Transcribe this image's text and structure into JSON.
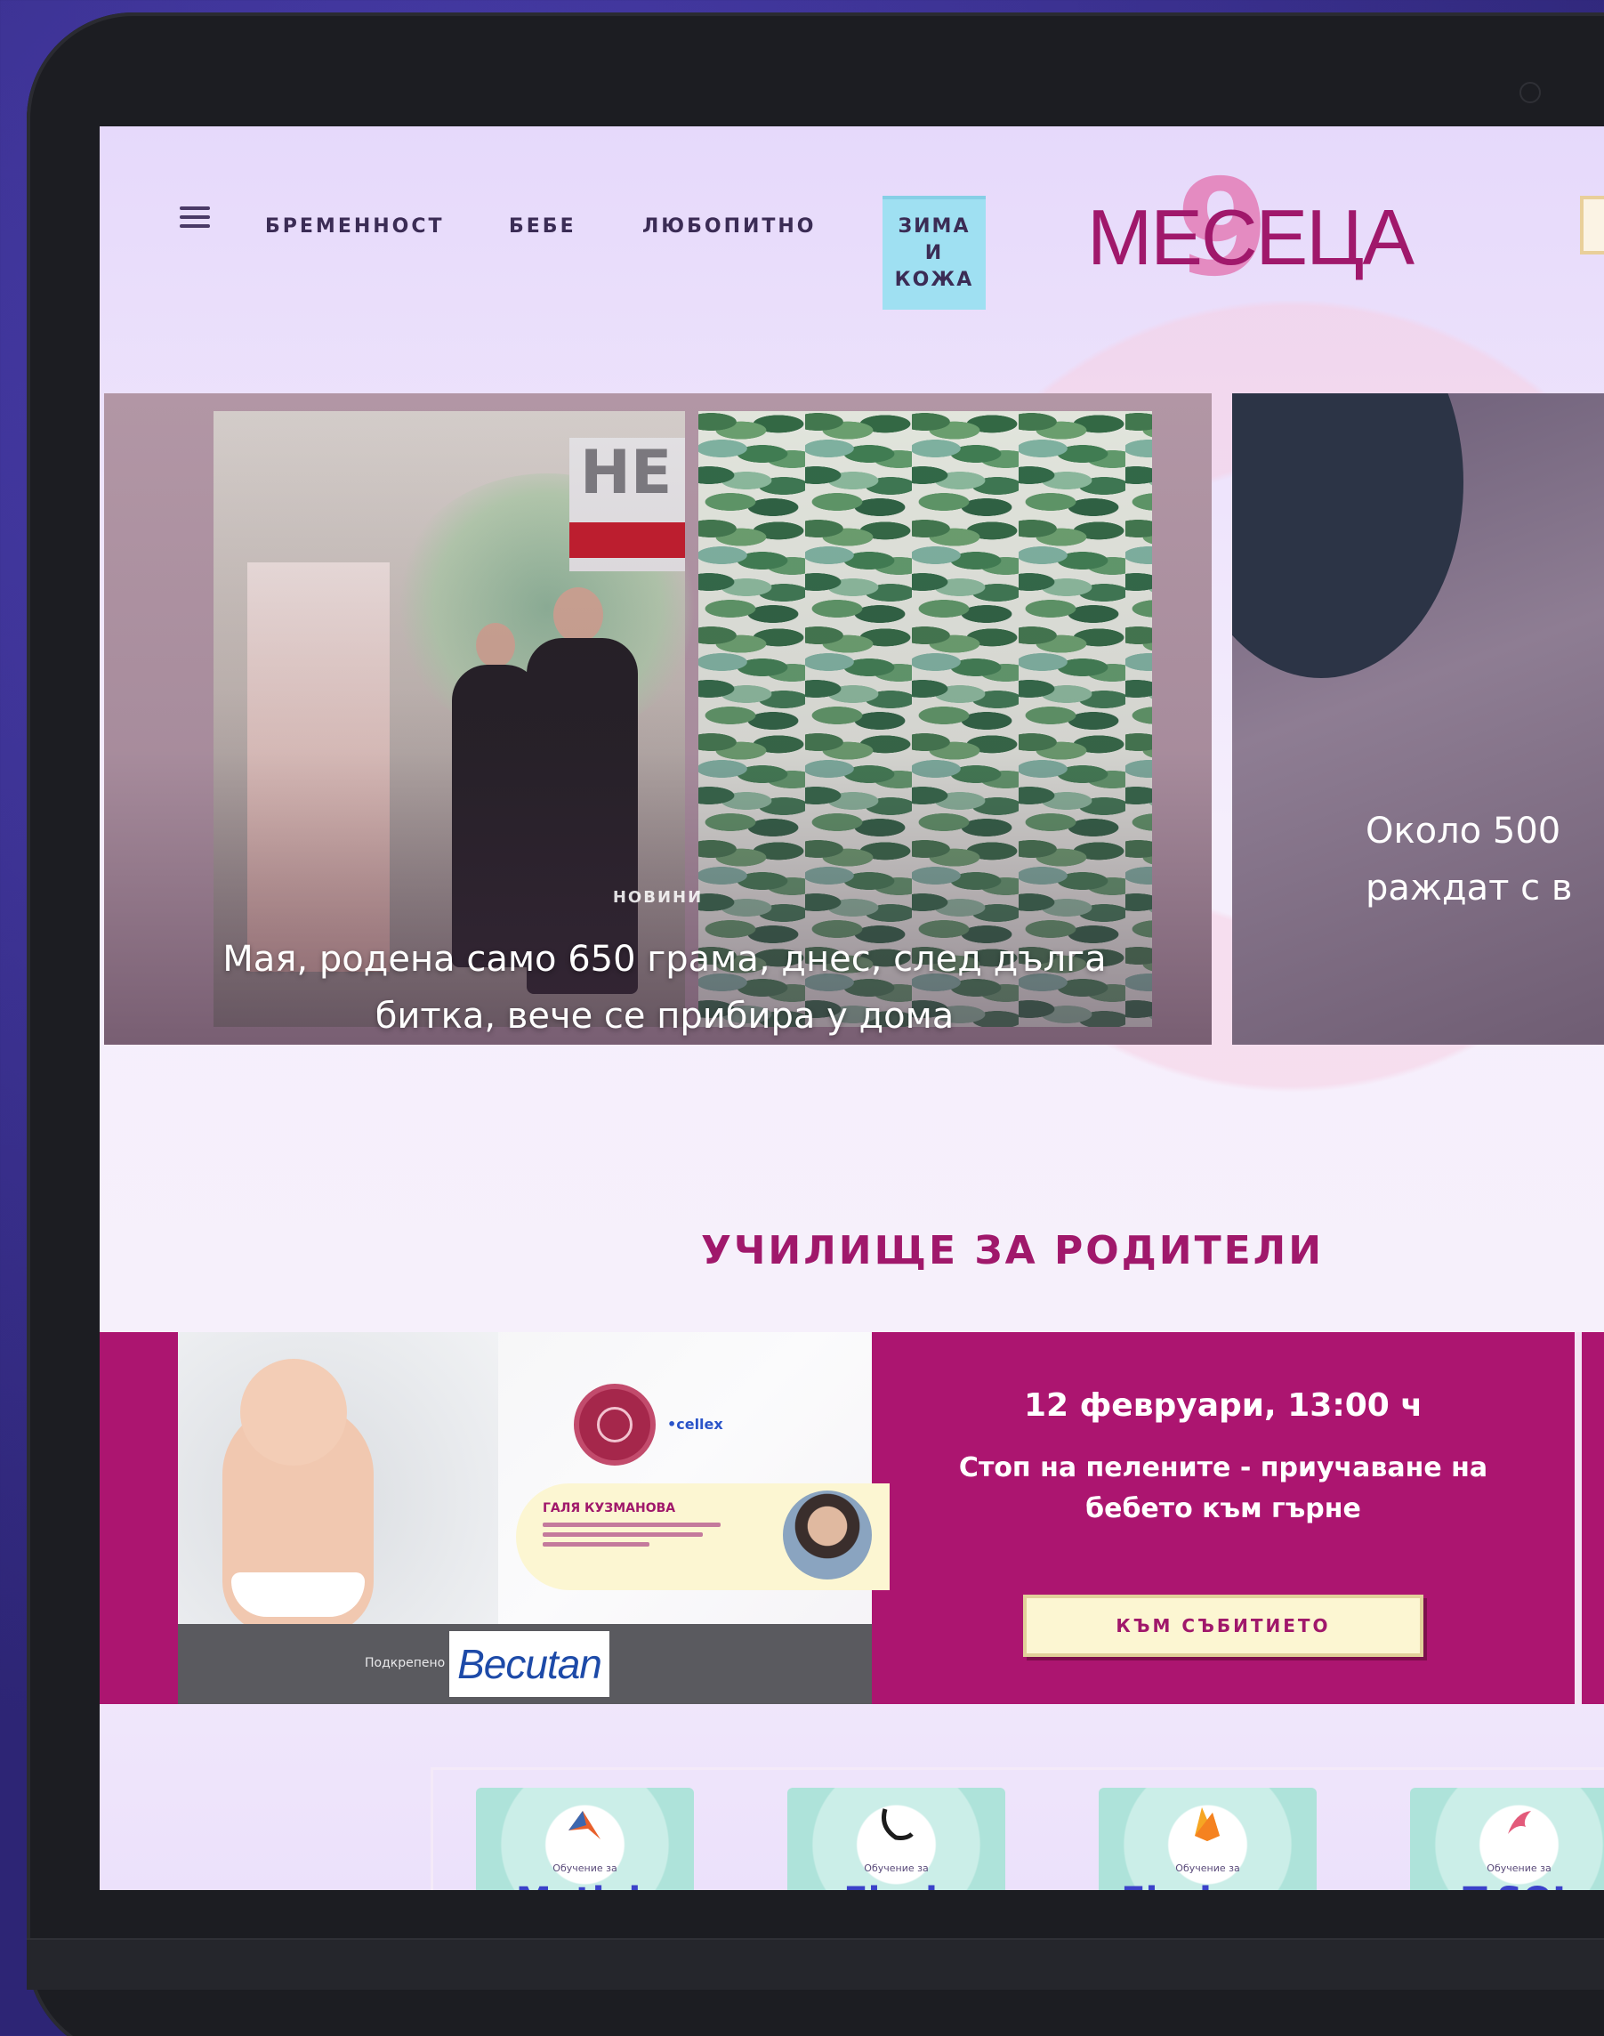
{
  "nav": {
    "items": [
      "БРЕМЕННОСТ",
      "БЕБЕ",
      "ЛЮБОПИТНО"
    ],
    "special_lines": [
      "ЗИМА",
      "И",
      "КОЖА"
    ]
  },
  "logo": {
    "numeral": "9",
    "text": "МЕСЕЦА"
  },
  "hero": {
    "main": {
      "sign": "НЕ",
      "tag": "НОВИНИ",
      "title": "Мая, родена само 650 грама, днес, след дълга битка, вече се прибира у дома"
    },
    "side": {
      "title_lines": [
        "Около 500",
        "раждат с в"
      ]
    }
  },
  "school": {
    "heading": "УЧИЛИЩЕ ЗА РОДИТЕЛИ"
  },
  "event": {
    "date": "12 февруари, 13:00 ч",
    "title": "Стоп на пелените - приучаване на бебето към гърне",
    "button": "КЪМ СЪБИТИЕТО",
    "speaker_name": "ГАЛЯ КУЗМАНОВА",
    "small_logo": "•cellex",
    "sponsor_label": "Подкрепено от",
    "sponsor_logo": "Becutan"
  },
  "courses": [
    {
      "icon": "matlab-icon",
      "subtitle": "Обучение за",
      "title": "Matlab"
    },
    {
      "icon": "flask-icon",
      "subtitle": "Обучение за",
      "title": "Flask"
    },
    {
      "icon": "firebase-icon",
      "subtitle": "Обучение за",
      "title": "Firebase"
    },
    {
      "icon": "tsql-icon",
      "subtitle": "Обучение за",
      "title": "T-SQL"
    }
  ],
  "colors": {
    "brand": "#a0186b",
    "event_bg": "#ac1570",
    "nav_special_bg": "#9fe0f2",
    "button_bg": "#fcf6d2",
    "course_title": "#3b41c9"
  }
}
